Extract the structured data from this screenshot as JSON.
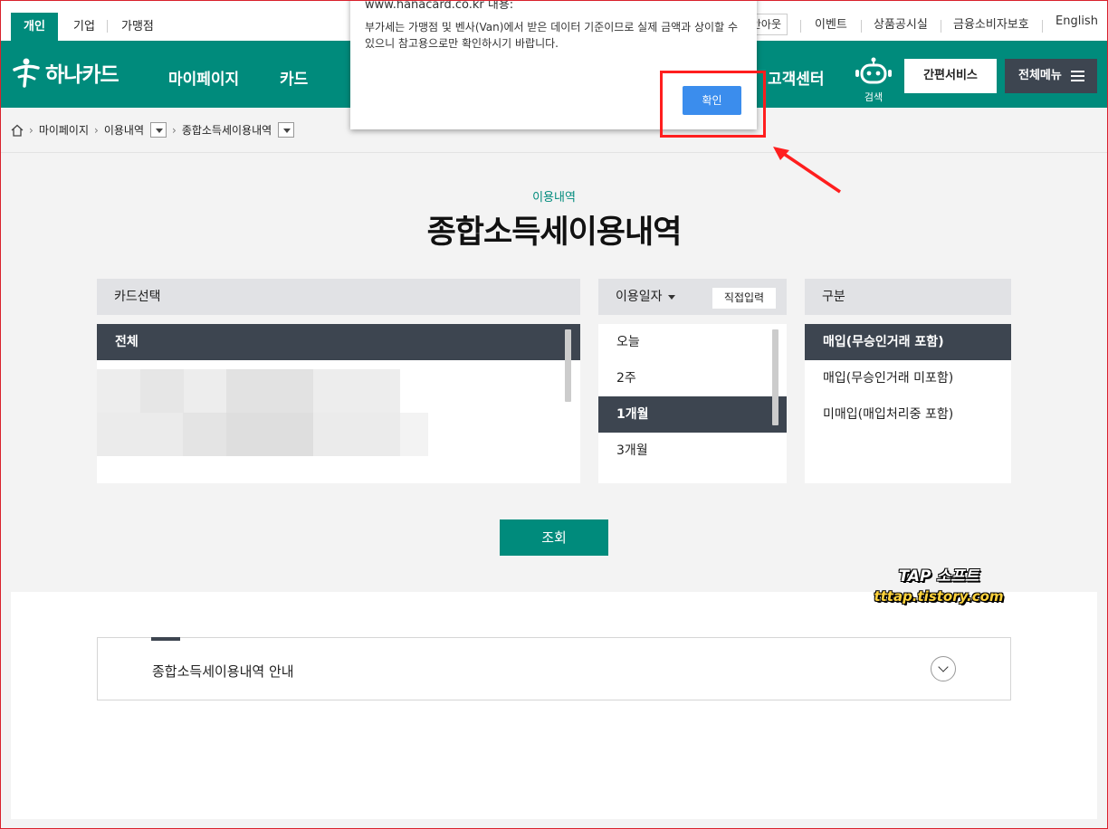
{
  "utility_bar": {
    "audience_tabs": [
      "개인",
      "기업",
      "가맹점"
    ],
    "logout_partial": "안아웃",
    "links": [
      "이벤트",
      "상품공시실",
      "금융소비자보호",
      "English"
    ]
  },
  "header": {
    "logo_text": "하나카드",
    "nav": [
      "마이페이지",
      "카드",
      "고객센터"
    ],
    "search_label": "검색",
    "quick_service": "간편서비스",
    "all_menu": "전체메뉴"
  },
  "breadcrumb": [
    "마이페이지",
    "이용내역",
    "종합소득세이용내역"
  ],
  "page": {
    "subtitle": "이용내역",
    "title": "종합소득세이용내역"
  },
  "card_panel": {
    "header": "카드선택",
    "items": [
      "전체"
    ]
  },
  "date_panel": {
    "header": "이용일자",
    "direct_input": "직접입력",
    "options": [
      "오늘",
      "2주",
      "1개월",
      "3개월"
    ],
    "selected": "1개월"
  },
  "type_panel": {
    "header": "구분",
    "options": [
      "매입(무승인거래 포함)",
      "매입(무승인거래 미포함)",
      "미매입(매입처리중 포함)"
    ],
    "selected": "매입(무승인거래 포함)"
  },
  "search_button": "조회",
  "watermark": {
    "line1": "TAP 소프트",
    "line2": "tttap.tistory.com"
  },
  "guide": {
    "title": "종합소득세이용내역 안내"
  },
  "dialog": {
    "origin": "www.hanacard.co.kr 내용:",
    "message": "부가세는 가맹점 및 벤사(Van)에서 받은 데이터 기준이므로 실제 금액과 상이할 수 있으니 참고용으로만 확인하시기 바랍니다.",
    "ok_label": "확인"
  },
  "colors": {
    "brand_green": "#008b7c",
    "dark_slate": "#3d4550",
    "dialog_blue": "#3b8ded",
    "annotation_red": "#ff1e1e"
  }
}
